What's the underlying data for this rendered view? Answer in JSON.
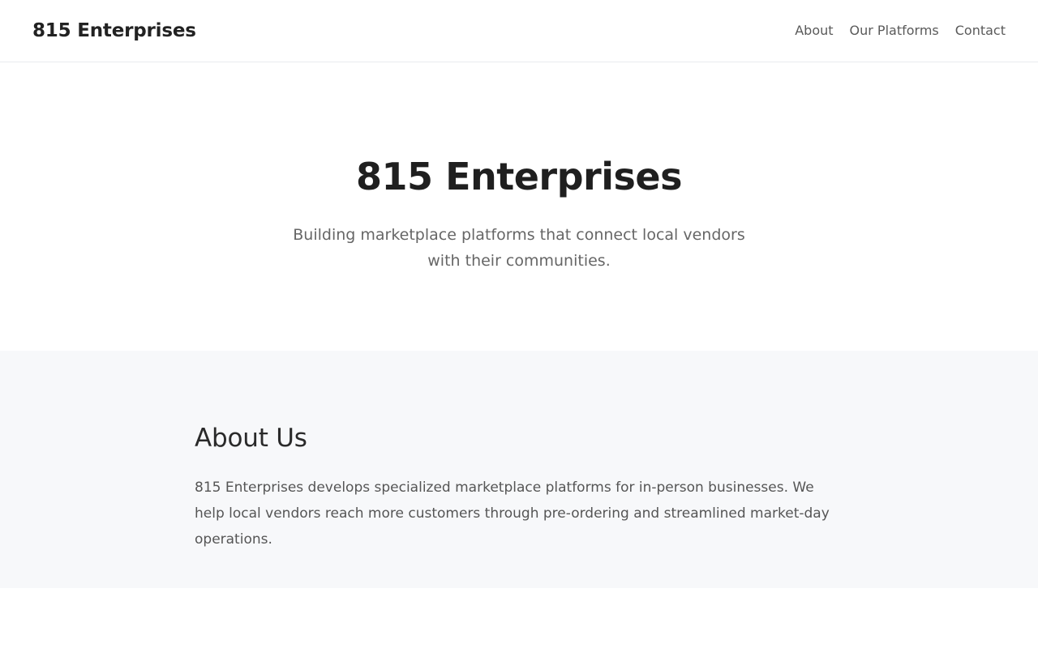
{
  "header": {
    "logo": "815 Enterprises",
    "nav": [
      {
        "label": "About"
      },
      {
        "label": "Our Platforms"
      },
      {
        "label": "Contact"
      }
    ]
  },
  "hero": {
    "title": "815 Enterprises",
    "subtitle": "Building marketplace platforms that connect local vendors with their communities."
  },
  "about": {
    "title": "About Us",
    "text": "815 Enterprises develops specialized marketplace platforms for in-person businesses. We help local vendors reach more customers through pre-ordering and streamlined market-day operations."
  },
  "colors": {
    "text_primary": "#222222",
    "text_muted": "#666666",
    "section_background": "#f7f8fa",
    "border": "#e9ebee"
  }
}
